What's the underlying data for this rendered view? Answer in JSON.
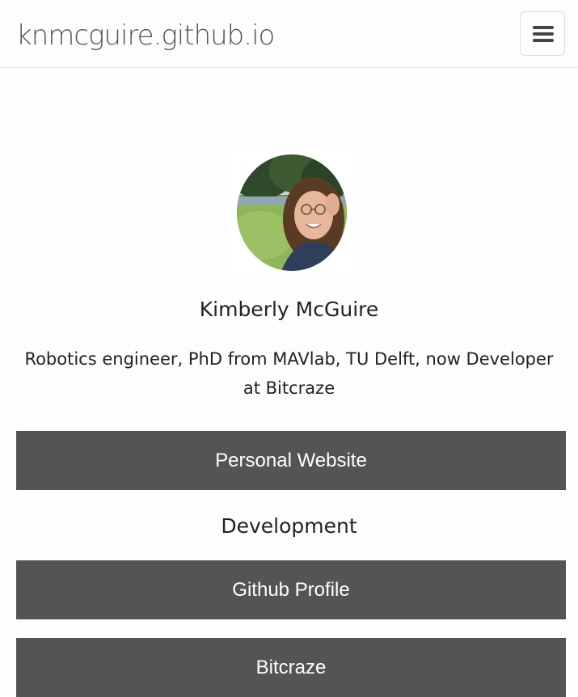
{
  "header": {
    "brand": "knmcguire.github.io",
    "menu_icon": "hamburger-menu-icon"
  },
  "profile": {
    "avatar_alt": "profile-photo",
    "name": "Kimberly McGuire",
    "bio": "Robotics engineer, PhD from MAVlab, TU Delft, now Developer at Bitcraze"
  },
  "links": {
    "personal_website": "Personal Website",
    "section_development": "Development",
    "github_profile": "Github Profile",
    "bitcraze": "Bitcraze"
  },
  "colors": {
    "button_bg": "#545454",
    "button_text": "#ffffff",
    "page_bg": "#fdfdfd"
  }
}
